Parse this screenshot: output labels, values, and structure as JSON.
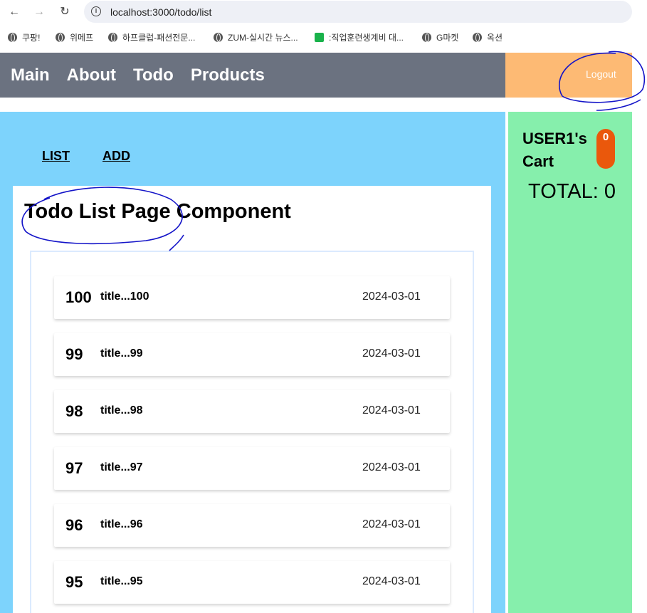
{
  "browser": {
    "url": "localhost:3000/todo/list",
    "bookmarks": [
      "쿠팡!",
      "위메프",
      "하프클럽-패션전문...",
      "ZUM-실시간 뉴스...",
      ":직업훈련생계비 대...",
      "G마켓",
      "옥션"
    ]
  },
  "header": {
    "nav": [
      "Main",
      "About",
      "Todo",
      "Products"
    ],
    "logout_label": "Logout"
  },
  "todo_menu": {
    "list_label": "LIST",
    "add_label": "ADD"
  },
  "page_title": "Todo List Page Component",
  "todos": [
    {
      "tno": "100",
      "title": "title...100",
      "date": "2024-03-01"
    },
    {
      "tno": "99",
      "title": "title...99",
      "date": "2024-03-01"
    },
    {
      "tno": "98",
      "title": "title...98",
      "date": "2024-03-01"
    },
    {
      "tno": "97",
      "title": "title...97",
      "date": "2024-03-01"
    },
    {
      "tno": "96",
      "title": "title...96",
      "date": "2024-03-01"
    },
    {
      "tno": "95",
      "title": "title...95",
      "date": "2024-03-01"
    }
  ],
  "cart": {
    "title": "USER1's Cart",
    "count": "0",
    "total": "TOTAL: 0"
  },
  "colors": {
    "header": "#6b7280",
    "logout_bg": "#fdba74",
    "main_bg": "#7dd3fc",
    "cart_bg": "#86efac",
    "badge": "#ea580c",
    "annotation": "#1414c8"
  }
}
